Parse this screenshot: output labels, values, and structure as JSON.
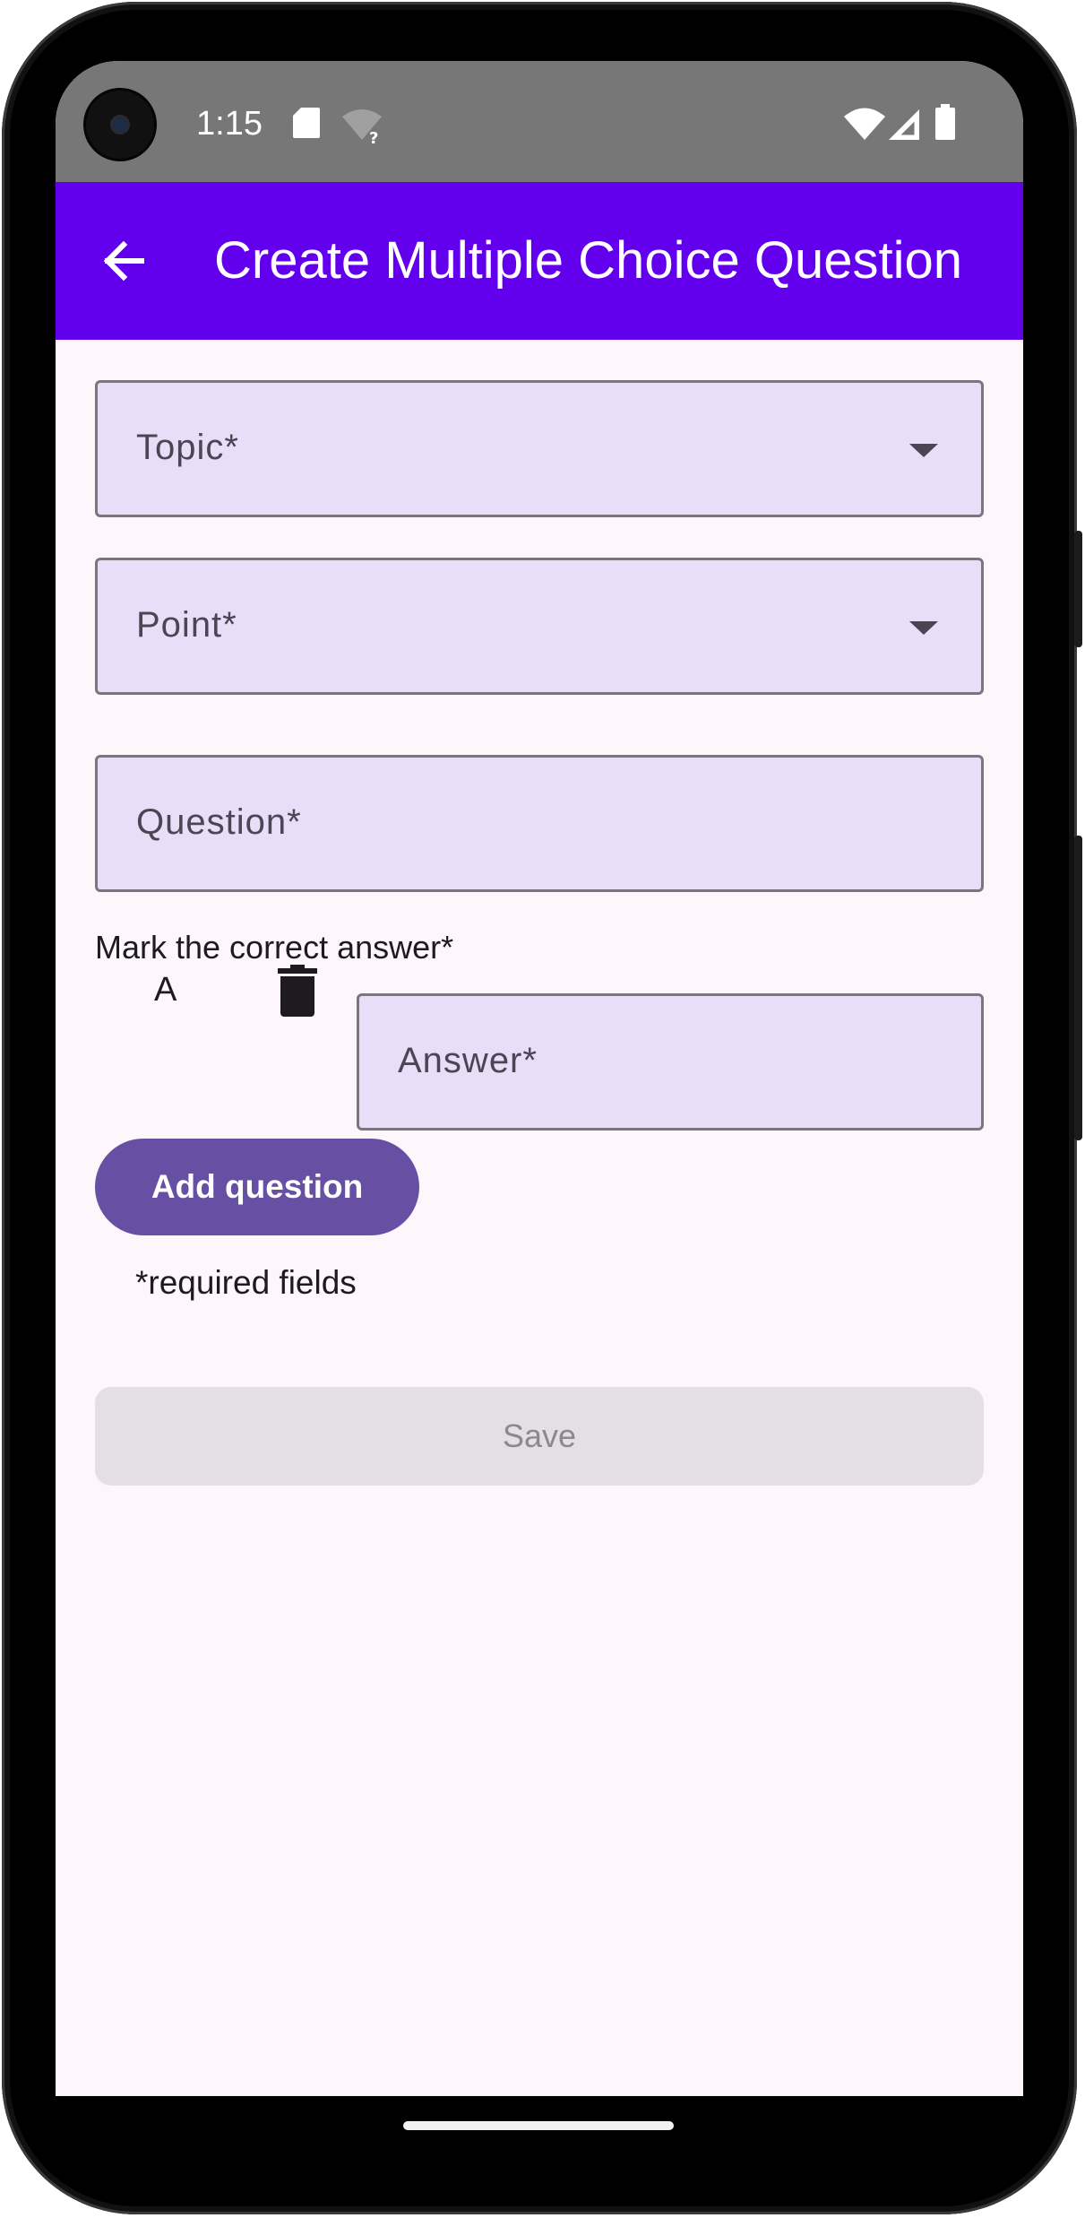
{
  "status_bar": {
    "time": "1:15",
    "icons": [
      "sd-card-icon",
      "wifi-unknown-icon",
      "wifi-icon",
      "cell-signal-icon",
      "battery-icon"
    ]
  },
  "app_bar": {
    "back_icon": "arrow-back-icon",
    "title": "Create Multiple Choice Question",
    "color": "#6200ee"
  },
  "form": {
    "topic_label": "Topic*",
    "point_label": "Point*",
    "question_label": "Question*",
    "mark_label": "Mark the correct answer*",
    "answers": [
      {
        "letter": "A",
        "delete_icon": "trash-icon",
        "label": "Answer*"
      }
    ],
    "add_question_label": "Add question",
    "required_note": "*required fields",
    "save_label": "Save"
  },
  "colors": {
    "field_fill": "#e8def8",
    "primary_button": "#6750a4",
    "disabled_button": "#e3dfe3",
    "background": "#fdf7fb"
  }
}
